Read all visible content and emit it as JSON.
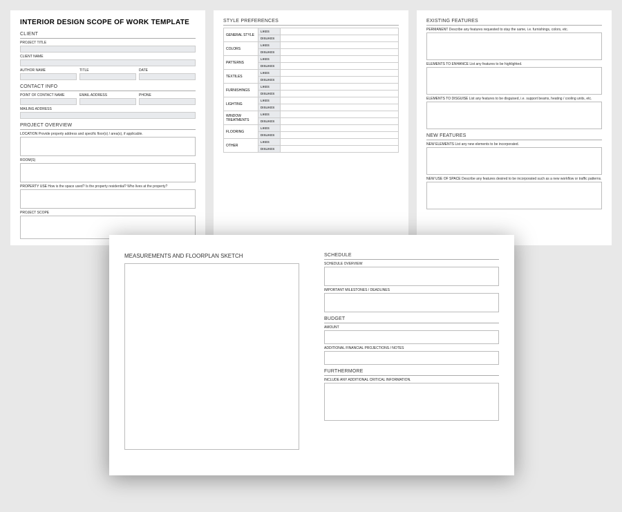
{
  "title": "INTERIOR DESIGN SCOPE OF WORK TEMPLATE",
  "client": {
    "header": "CLIENT",
    "project_title": "PROJECT TITLE",
    "client_name": "CLIENT NAME",
    "author_name": "AUTHOR NAME",
    "title_lbl": "TITLE",
    "date": "DATE"
  },
  "contact": {
    "header": "CONTACT INFO",
    "poc": "POINT OF CONTACT NAME",
    "email": "EMAIL ADDRESS",
    "phone": "PHONE",
    "mailing": "MAILING ADDRESS"
  },
  "overview": {
    "header": "PROJECT OVERVIEW",
    "location": "LOCATION",
    "location_hint": "Provide property address and specific floor(s) / area(s), if applicable.",
    "rooms": "ROOM(S)",
    "property_use": "PROPERTY USE",
    "property_use_hint": "How is the space used? Is the property residential? Who lives at the property?",
    "scope": "PROJECT SCOPE"
  },
  "style": {
    "header": "STYLE PREFERENCES",
    "likes": "LIKES",
    "dislikes": "DISLIKES",
    "cats": [
      "GENERAL STYLE",
      "COLORS",
      "PATTERNS",
      "TEXTILES",
      "FURNISHINGS",
      "LIGHTING",
      "WINDOW TREATMENTS",
      "FLOORING",
      "OTHER"
    ]
  },
  "existing": {
    "header": "EXISTING FEATURES",
    "permanent": "PERMANENT",
    "permanent_hint": "Describe any features requested to stay the same, i.e. furnishings, colors, etc.",
    "enhance": "ELEMENTS TO ENHANCE",
    "enhance_hint": "List any features to be highlighted.",
    "disguise": "ELEMENTS TO DISGUISE",
    "disguise_hint": "List any features to be disguised, i.e. support beams, heating / cooling units, etc."
  },
  "newfeat": {
    "header": "NEW FEATURES",
    "elements": "NEW ELEMENTS",
    "elements_hint": "List any new elements to be incorporated.",
    "use": "NEW USE OF SPACE",
    "use_hint": "Describe any features desired to be incorporated such as a new workflow or traffic patterns."
  },
  "measure": {
    "header": "MEASUREMENTS AND FLOORPLAN SKETCH"
  },
  "schedule": {
    "header": "SCHEDULE",
    "overview": "SCHEDULE OVERVIEW",
    "milestones": "IMPORTANT MILESTONES / DEADLINES"
  },
  "budget": {
    "header": "BUDGET",
    "amount": "AMOUNT",
    "notes": "ADDITIONAL FINANCIAL PROJECTIONS / NOTES"
  },
  "further": {
    "header": "FURTHERMORE",
    "hint": "Include any additional critical information."
  }
}
